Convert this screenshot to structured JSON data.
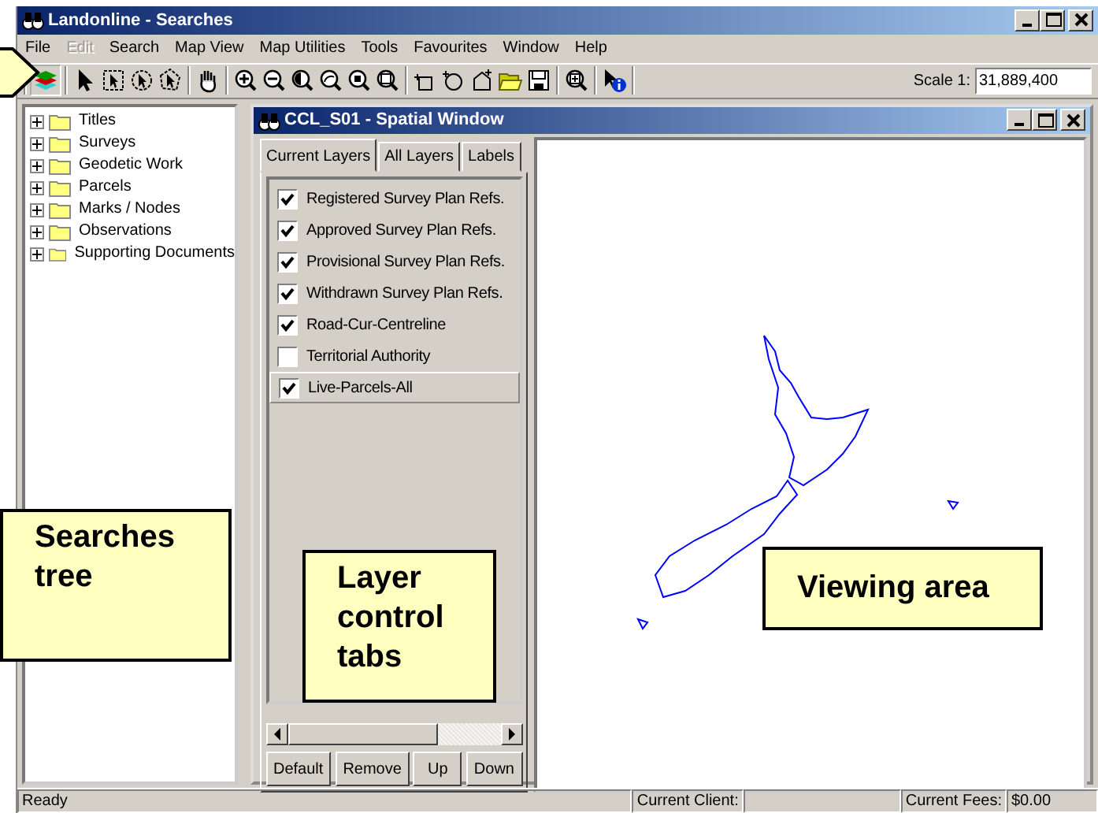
{
  "window": {
    "title": "Landonline - Searches"
  },
  "menu": [
    {
      "label": "File",
      "disabled": false
    },
    {
      "label": "Edit",
      "disabled": true
    },
    {
      "label": "Search",
      "disabled": false
    },
    {
      "label": "Map View",
      "disabled": false
    },
    {
      "label": "Map Utilities",
      "disabled": false
    },
    {
      "label": "Tools",
      "disabled": false
    },
    {
      "label": "Favourites",
      "disabled": false
    },
    {
      "label": "Window",
      "disabled": false
    },
    {
      "label": "Help",
      "disabled": false
    }
  ],
  "toolbar": {
    "scale_label": "Scale 1:",
    "scale_value": "31,889,400"
  },
  "tree": [
    {
      "label": "Titles"
    },
    {
      "label": "Surveys"
    },
    {
      "label": "Geodetic Work"
    },
    {
      "label": "Parcels"
    },
    {
      "label": "Marks / Nodes"
    },
    {
      "label": "Observations"
    },
    {
      "label": "Supporting Documents"
    }
  ],
  "spatial_window": {
    "title": "CCL_S01 - Spatial Window",
    "tabs": [
      {
        "label": "Current Layers",
        "selected": true
      },
      {
        "label": "All Layers",
        "selected": false
      },
      {
        "label": "Labels",
        "selected": false
      }
    ],
    "layers": [
      {
        "label": "Registered Survey Plan Refs.",
        "checked": true,
        "selected": false
      },
      {
        "label": "Approved Survey Plan Refs.",
        "checked": true,
        "selected": false
      },
      {
        "label": "Provisional Survey Plan Refs.",
        "checked": true,
        "selected": false
      },
      {
        "label": "Withdrawn Survey Plan Refs.",
        "checked": true,
        "selected": false
      },
      {
        "label": "Road-Cur-Centreline",
        "checked": true,
        "selected": false
      },
      {
        "label": "Territorial Authority",
        "checked": false,
        "selected": false
      },
      {
        "label": "Live-Parcels-All",
        "checked": true,
        "selected": true
      }
    ],
    "buttons": [
      "Default",
      "Remove",
      "Up",
      "Down"
    ]
  },
  "status_bar": {
    "text": "Ready",
    "client_label": "Current Client:",
    "fees_label": "Current Fees:",
    "fees_value": "$0.00"
  },
  "callouts": [
    {
      "text": "Searches tree"
    },
    {
      "text": "Layer control tabs"
    },
    {
      "text": "Viewing area"
    }
  ]
}
